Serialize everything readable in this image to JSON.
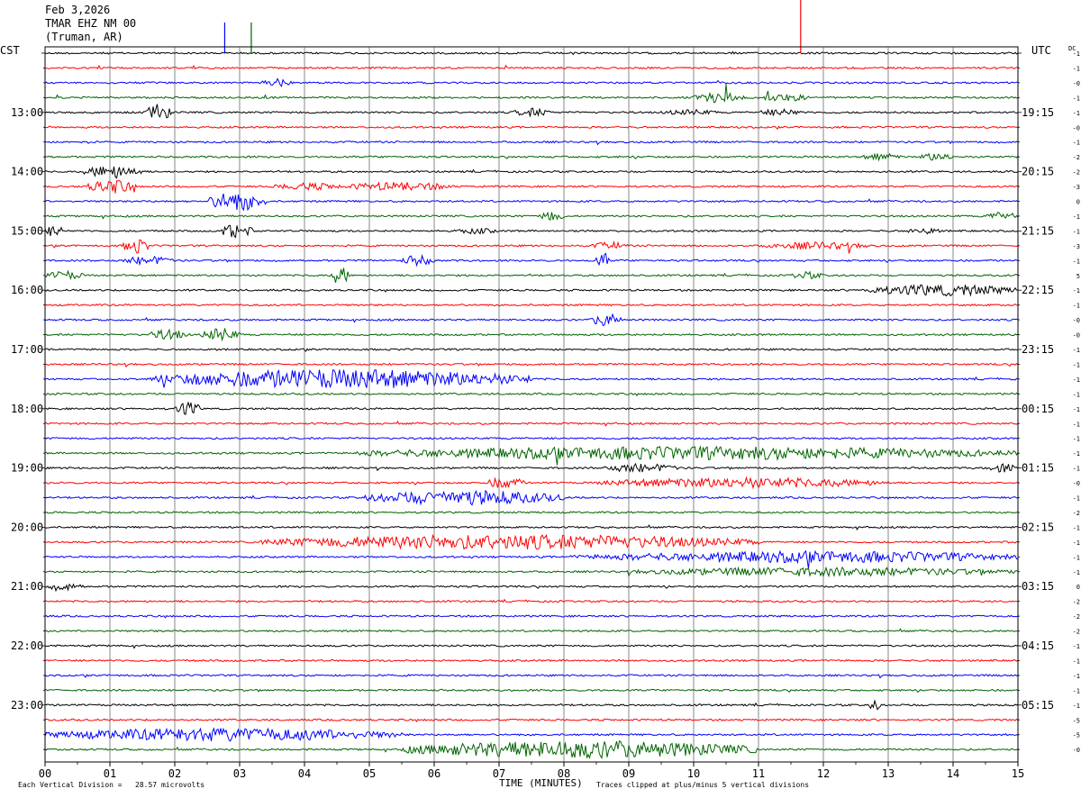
{
  "header": {
    "date": "Feb 3,2026",
    "station": "TMAR EHZ NM 00",
    "location": "(Truman, AR)"
  },
  "left_axis_title": "CST",
  "right_axis_title": "UTC",
  "dc_label": "DC",
  "footer": {
    "vertical_division": "Each Vertical Division =   28.57 microvolts",
    "x_axis_title": "TIME (MINUTES)",
    "clip_note": "Traces clipped at plus/minus 5 vertical divisions"
  },
  "chart_data": {
    "type": "line",
    "title": "",
    "xlabel": "TIME (MINUTES)",
    "xlim": [
      0,
      15
    ],
    "x_ticks": [
      "00",
      "01",
      "02",
      "03",
      "04",
      "05",
      "06",
      "07",
      "08",
      "09",
      "10",
      "11",
      "12",
      "13",
      "14",
      "15"
    ],
    "trace_count": 48,
    "trace_colors": [
      "#000000",
      "#ff0000",
      "#0000ff",
      "#006400"
    ],
    "left_time_labels": [
      {
        "row": 4,
        "label": "13:00"
      },
      {
        "row": 8,
        "label": "14:00"
      },
      {
        "row": 12,
        "label": "15:00"
      },
      {
        "row": 16,
        "label": "16:00"
      },
      {
        "row": 20,
        "label": "17:00"
      },
      {
        "row": 24,
        "label": "18:00"
      },
      {
        "row": 28,
        "label": "19:00"
      },
      {
        "row": 32,
        "label": "20:00"
      },
      {
        "row": 36,
        "label": "21:00"
      },
      {
        "row": 40,
        "label": "22:00"
      },
      {
        "row": 44,
        "label": "23:00"
      }
    ],
    "right_time_labels": [
      {
        "row": 4,
        "label": "19:15"
      },
      {
        "row": 8,
        "label": "20:15"
      },
      {
        "row": 12,
        "label": "21:15"
      },
      {
        "row": 16,
        "label": "22:15"
      },
      {
        "row": 20,
        "label": "23:15"
      },
      {
        "row": 24,
        "label": "00:15"
      },
      {
        "row": 28,
        "label": "01:15"
      },
      {
        "row": 32,
        "label": "02:15"
      },
      {
        "row": 36,
        "label": "03:15"
      },
      {
        "row": 40,
        "label": "04:15"
      },
      {
        "row": 44,
        "label": "05:15"
      }
    ],
    "dc_offsets": [
      "-1",
      "-1",
      "-0",
      "-1",
      "-1",
      "-0",
      "-1",
      "-2",
      "-2",
      "-3",
      "0",
      "-1",
      "-1",
      "-3",
      "-1",
      "5",
      "-1",
      "-1",
      "-0",
      "-0",
      "-1",
      "-1",
      "-1",
      "-1",
      "-1",
      "-1",
      "-1",
      "-1",
      "-1",
      "-0",
      "-1",
      "-2",
      "-1",
      "-1",
      "-1",
      "-1",
      "0",
      "-2",
      "-2",
      "-2",
      "-1",
      "-1",
      "-1",
      "-1",
      "-1",
      "-5",
      "-5",
      "-0"
    ],
    "activity_bursts": [
      {
        "trace": 2,
        "start": 3.3,
        "end": 3.8,
        "amp": 0.6
      },
      {
        "trace": 3,
        "start": 10.0,
        "end": 10.8,
        "amp": 0.7
      },
      {
        "trace": 3,
        "start": 11.0,
        "end": 11.8,
        "amp": 0.5
      },
      {
        "trace": 4,
        "start": 1.55,
        "end": 1.95,
        "amp": 1.2
      },
      {
        "trace": 4,
        "start": 7.2,
        "end": 7.8,
        "amp": 0.6
      },
      {
        "trace": 4,
        "start": 9.5,
        "end": 10.4,
        "amp": 0.4
      },
      {
        "trace": 4,
        "start": 11.0,
        "end": 11.7,
        "amp": 0.5
      },
      {
        "trace": 6,
        "start": 0.6,
        "end": 0.7,
        "amp": 0.6
      },
      {
        "trace": 7,
        "start": 12.6,
        "end": 13.2,
        "amp": 0.5
      },
      {
        "trace": 7,
        "start": 13.5,
        "end": 14.0,
        "amp": 0.6
      },
      {
        "trace": 8,
        "start": 0.6,
        "end": 1.5,
        "amp": 0.9
      },
      {
        "trace": 9,
        "start": 0.65,
        "end": 1.4,
        "amp": 1.0
      },
      {
        "trace": 9,
        "start": 3.5,
        "end": 4.6,
        "amp": 0.5
      },
      {
        "trace": 9,
        "start": 4.6,
        "end": 6.3,
        "amp": 0.6
      },
      {
        "trace": 10,
        "start": 2.5,
        "end": 3.4,
        "amp": 1.3
      },
      {
        "trace": 11,
        "start": 7.6,
        "end": 8.0,
        "amp": 0.7
      },
      {
        "trace": 11,
        "start": 14.5,
        "end": 15.0,
        "amp": 0.6
      },
      {
        "trace": 12,
        "start": 0.0,
        "end": 0.3,
        "amp": 0.8
      },
      {
        "trace": 12,
        "start": 2.7,
        "end": 3.2,
        "amp": 1.0
      },
      {
        "trace": 12,
        "start": 6.3,
        "end": 7.0,
        "amp": 0.4
      },
      {
        "trace": 12,
        "start": 13.3,
        "end": 13.8,
        "amp": 0.5
      },
      {
        "trace": 13,
        "start": 1.2,
        "end": 1.6,
        "amp": 1.1
      },
      {
        "trace": 13,
        "start": 8.4,
        "end": 9.0,
        "amp": 0.5
      },
      {
        "trace": 13,
        "start": 11.0,
        "end": 12.8,
        "amp": 0.5
      },
      {
        "trace": 14,
        "start": 1.2,
        "end": 2.0,
        "amp": 0.6
      },
      {
        "trace": 14,
        "start": 5.5,
        "end": 6.0,
        "amp": 0.7
      },
      {
        "trace": 14,
        "start": 8.5,
        "end": 8.7,
        "amp": 1.2
      },
      {
        "trace": 15,
        "start": 0.0,
        "end": 0.6,
        "amp": 0.6
      },
      {
        "trace": 15,
        "start": 4.4,
        "end": 4.7,
        "amp": 1.2
      },
      {
        "trace": 15,
        "start": 11.5,
        "end": 12.0,
        "amp": 0.5
      },
      {
        "trace": 16,
        "start": 12.6,
        "end": 15.0,
        "amp": 0.8
      },
      {
        "trace": 18,
        "start": 8.4,
        "end": 8.9,
        "amp": 0.9
      },
      {
        "trace": 19,
        "start": 1.6,
        "end": 2.2,
        "amp": 0.7
      },
      {
        "trace": 19,
        "start": 2.4,
        "end": 3.0,
        "amp": 0.9
      },
      {
        "trace": 22,
        "start": 1.6,
        "end": 7.5,
        "amp": 1.3
      },
      {
        "trace": 24,
        "start": 2.0,
        "end": 2.4,
        "amp": 1.0
      },
      {
        "trace": 27,
        "start": 4.8,
        "end": 15.0,
        "amp": 0.9
      },
      {
        "trace": 28,
        "start": 8.6,
        "end": 9.8,
        "amp": 0.6
      },
      {
        "trace": 28,
        "start": 14.5,
        "end": 15.0,
        "amp": 0.6
      },
      {
        "trace": 29,
        "start": 6.8,
        "end": 7.4,
        "amp": 0.8
      },
      {
        "trace": 29,
        "start": 8.5,
        "end": 13.0,
        "amp": 0.7
      },
      {
        "trace": 30,
        "start": 4.9,
        "end": 8.0,
        "amp": 1.0
      },
      {
        "trace": 33,
        "start": 3.3,
        "end": 11.0,
        "amp": 1.0
      },
      {
        "trace": 34,
        "start": 8.0,
        "end": 11.5,
        "amp": 0.5
      },
      {
        "trace": 34,
        "start": 9.0,
        "end": 15.0,
        "amp": 0.8
      },
      {
        "trace": 35,
        "start": 9.0,
        "end": 15.0,
        "amp": 0.6
      },
      {
        "trace": 36,
        "start": 0.0,
        "end": 0.6,
        "amp": 0.5
      },
      {
        "trace": 44,
        "start": 12.7,
        "end": 12.9,
        "amp": 0.7
      },
      {
        "trace": 46,
        "start": 0.0,
        "end": 5.5,
        "amp": 0.9
      },
      {
        "trace": 47,
        "start": 5.5,
        "end": 11.0,
        "amp": 1.2
      }
    ],
    "clipped_spikes": [
      {
        "trace": 0,
        "x": 2.77,
        "color": "#0000ff"
      },
      {
        "trace": 0,
        "x": 3.18,
        "color": "#006400"
      },
      {
        "trace": 0,
        "x": 11.65,
        "color": "#ff0000"
      }
    ],
    "grid": true
  }
}
